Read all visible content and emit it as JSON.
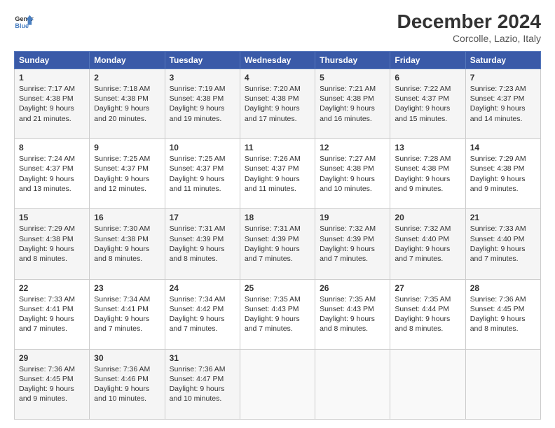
{
  "header": {
    "logo_line1": "General",
    "logo_line2": "Blue",
    "main_title": "December 2024",
    "subtitle": "Corcolle, Lazio, Italy"
  },
  "weekdays": [
    "Sunday",
    "Monday",
    "Tuesday",
    "Wednesday",
    "Thursday",
    "Friday",
    "Saturday"
  ],
  "weeks": [
    [
      {
        "day": "1",
        "lines": [
          "Sunrise: 7:17 AM",
          "Sunset: 4:38 PM",
          "Daylight: 9 hours",
          "and 21 minutes."
        ]
      },
      {
        "day": "2",
        "lines": [
          "Sunrise: 7:18 AM",
          "Sunset: 4:38 PM",
          "Daylight: 9 hours",
          "and 20 minutes."
        ]
      },
      {
        "day": "3",
        "lines": [
          "Sunrise: 7:19 AM",
          "Sunset: 4:38 PM",
          "Daylight: 9 hours",
          "and 19 minutes."
        ]
      },
      {
        "day": "4",
        "lines": [
          "Sunrise: 7:20 AM",
          "Sunset: 4:38 PM",
          "Daylight: 9 hours",
          "and 17 minutes."
        ]
      },
      {
        "day": "5",
        "lines": [
          "Sunrise: 7:21 AM",
          "Sunset: 4:38 PM",
          "Daylight: 9 hours",
          "and 16 minutes."
        ]
      },
      {
        "day": "6",
        "lines": [
          "Sunrise: 7:22 AM",
          "Sunset: 4:37 PM",
          "Daylight: 9 hours",
          "and 15 minutes."
        ]
      },
      {
        "day": "7",
        "lines": [
          "Sunrise: 7:23 AM",
          "Sunset: 4:37 PM",
          "Daylight: 9 hours",
          "and 14 minutes."
        ]
      }
    ],
    [
      {
        "day": "8",
        "lines": [
          "Sunrise: 7:24 AM",
          "Sunset: 4:37 PM",
          "Daylight: 9 hours",
          "and 13 minutes."
        ]
      },
      {
        "day": "9",
        "lines": [
          "Sunrise: 7:25 AM",
          "Sunset: 4:37 PM",
          "Daylight: 9 hours",
          "and 12 minutes."
        ]
      },
      {
        "day": "10",
        "lines": [
          "Sunrise: 7:25 AM",
          "Sunset: 4:37 PM",
          "Daylight: 9 hours",
          "and 11 minutes."
        ]
      },
      {
        "day": "11",
        "lines": [
          "Sunrise: 7:26 AM",
          "Sunset: 4:37 PM",
          "Daylight: 9 hours",
          "and 11 minutes."
        ]
      },
      {
        "day": "12",
        "lines": [
          "Sunrise: 7:27 AM",
          "Sunset: 4:38 PM",
          "Daylight: 9 hours",
          "and 10 minutes."
        ]
      },
      {
        "day": "13",
        "lines": [
          "Sunrise: 7:28 AM",
          "Sunset: 4:38 PM",
          "Daylight: 9 hours",
          "and 9 minutes."
        ]
      },
      {
        "day": "14",
        "lines": [
          "Sunrise: 7:29 AM",
          "Sunset: 4:38 PM",
          "Daylight: 9 hours",
          "and 9 minutes."
        ]
      }
    ],
    [
      {
        "day": "15",
        "lines": [
          "Sunrise: 7:29 AM",
          "Sunset: 4:38 PM",
          "Daylight: 9 hours",
          "and 8 minutes."
        ]
      },
      {
        "day": "16",
        "lines": [
          "Sunrise: 7:30 AM",
          "Sunset: 4:38 PM",
          "Daylight: 9 hours",
          "and 8 minutes."
        ]
      },
      {
        "day": "17",
        "lines": [
          "Sunrise: 7:31 AM",
          "Sunset: 4:39 PM",
          "Daylight: 9 hours",
          "and 8 minutes."
        ]
      },
      {
        "day": "18",
        "lines": [
          "Sunrise: 7:31 AM",
          "Sunset: 4:39 PM",
          "Daylight: 9 hours",
          "and 7 minutes."
        ]
      },
      {
        "day": "19",
        "lines": [
          "Sunrise: 7:32 AM",
          "Sunset: 4:39 PM",
          "Daylight: 9 hours",
          "and 7 minutes."
        ]
      },
      {
        "day": "20",
        "lines": [
          "Sunrise: 7:32 AM",
          "Sunset: 4:40 PM",
          "Daylight: 9 hours",
          "and 7 minutes."
        ]
      },
      {
        "day": "21",
        "lines": [
          "Sunrise: 7:33 AM",
          "Sunset: 4:40 PM",
          "Daylight: 9 hours",
          "and 7 minutes."
        ]
      }
    ],
    [
      {
        "day": "22",
        "lines": [
          "Sunrise: 7:33 AM",
          "Sunset: 4:41 PM",
          "Daylight: 9 hours",
          "and 7 minutes."
        ]
      },
      {
        "day": "23",
        "lines": [
          "Sunrise: 7:34 AM",
          "Sunset: 4:41 PM",
          "Daylight: 9 hours",
          "and 7 minutes."
        ]
      },
      {
        "day": "24",
        "lines": [
          "Sunrise: 7:34 AM",
          "Sunset: 4:42 PM",
          "Daylight: 9 hours",
          "and 7 minutes."
        ]
      },
      {
        "day": "25",
        "lines": [
          "Sunrise: 7:35 AM",
          "Sunset: 4:43 PM",
          "Daylight: 9 hours",
          "and 7 minutes."
        ]
      },
      {
        "day": "26",
        "lines": [
          "Sunrise: 7:35 AM",
          "Sunset: 4:43 PM",
          "Daylight: 9 hours",
          "and 8 minutes."
        ]
      },
      {
        "day": "27",
        "lines": [
          "Sunrise: 7:35 AM",
          "Sunset: 4:44 PM",
          "Daylight: 9 hours",
          "and 8 minutes."
        ]
      },
      {
        "day": "28",
        "lines": [
          "Sunrise: 7:36 AM",
          "Sunset: 4:45 PM",
          "Daylight: 9 hours",
          "and 8 minutes."
        ]
      }
    ],
    [
      {
        "day": "29",
        "lines": [
          "Sunrise: 7:36 AM",
          "Sunset: 4:45 PM",
          "Daylight: 9 hours",
          "and 9 minutes."
        ]
      },
      {
        "day": "30",
        "lines": [
          "Sunrise: 7:36 AM",
          "Sunset: 4:46 PM",
          "Daylight: 9 hours",
          "and 10 minutes."
        ]
      },
      {
        "day": "31",
        "lines": [
          "Sunrise: 7:36 AM",
          "Sunset: 4:47 PM",
          "Daylight: 9 hours",
          "and 10 minutes."
        ]
      },
      null,
      null,
      null,
      null
    ]
  ]
}
